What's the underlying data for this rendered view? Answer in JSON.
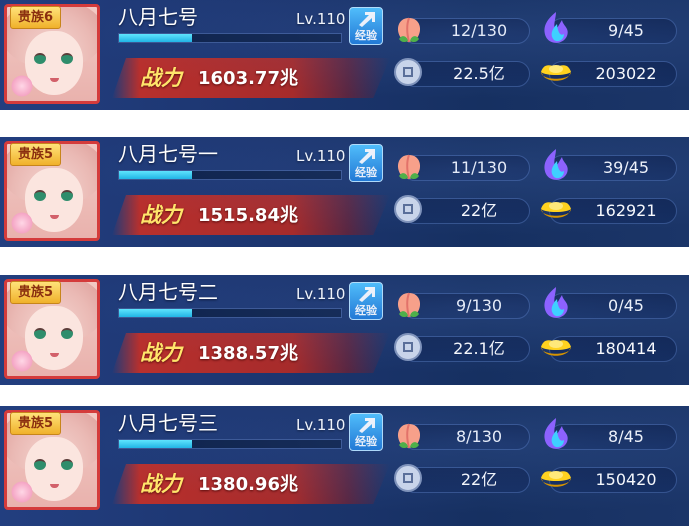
{
  "exp_label": "经验",
  "power_label": "战力",
  "cards": [
    {
      "badge": "贵族6",
      "name": "八月七号",
      "level": "Lv.110",
      "exp_fill": 0.33,
      "power": "1603.77兆",
      "peach": "12/130",
      "flame": "9/45",
      "coin": "22.5亿",
      "gold": "203022"
    },
    {
      "badge": "贵族5",
      "name": "八月七号一",
      "level": "Lv.110",
      "exp_fill": 0.33,
      "power": "1515.84兆",
      "peach": "11/130",
      "flame": "39/45",
      "coin": "22亿",
      "gold": "162921"
    },
    {
      "badge": "贵族5",
      "name": "八月七号二",
      "level": "Lv.110",
      "exp_fill": 0.33,
      "power": "1388.57兆",
      "peach": "9/130",
      "flame": "0/45",
      "coin": "22.1亿",
      "gold": "180414"
    },
    {
      "badge": "贵族5",
      "name": "八月七号三",
      "level": "Lv.110",
      "exp_fill": 0.33,
      "power": "1380.96兆",
      "peach": "8/130",
      "flame": "8/45",
      "coin": "22亿",
      "gold": "150420"
    }
  ],
  "colors": {
    "power_text": "#ffe56b",
    "exp_fill": "#1fb6e6",
    "badge_bg": "#f0b12b",
    "frame": "#d43b3b"
  },
  "icons": {
    "peach": "peach-icon",
    "flame": "spirit-flame-icon",
    "coin": "silver-coin-icon",
    "gold": "gold-ingot-icon",
    "exp": "exp-up-arrow-icon"
  }
}
